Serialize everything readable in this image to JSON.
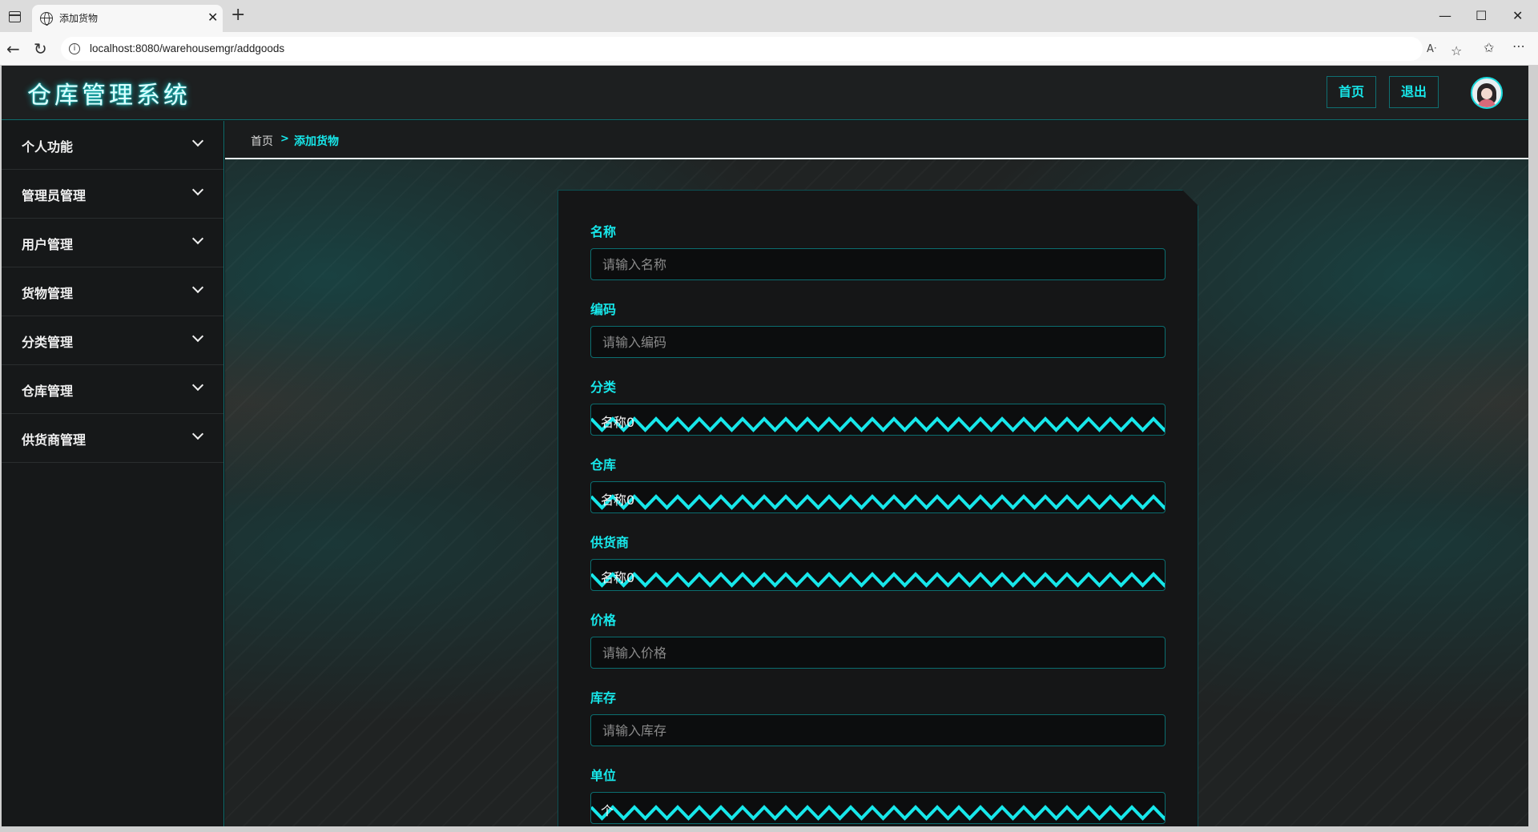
{
  "browser": {
    "tab_title": "添加货物",
    "tab_close": "✕",
    "new_tab": "+",
    "url": "localhost:8080/warehousemgr/addgoods",
    "window_controls": [
      "—",
      "☐",
      "✕"
    ]
  },
  "app": {
    "title": "仓库管理系统",
    "header_buttons": {
      "home": "首页",
      "logout": "退出"
    },
    "accent_color": "#17e7ea"
  },
  "sidebar": {
    "items": [
      {
        "label": "个人功能"
      },
      {
        "label": "管理员管理"
      },
      {
        "label": "用户管理"
      },
      {
        "label": "货物管理"
      },
      {
        "label": "分类管理"
      },
      {
        "label": "仓库管理"
      },
      {
        "label": "供货商管理"
      }
    ]
  },
  "breadcrumb": {
    "home": "首页",
    "separator": ">",
    "current": "添加货物"
  },
  "form": {
    "name": {
      "label": "名称",
      "placeholder": "请输入名称"
    },
    "code": {
      "label": "编码",
      "placeholder": "请输入编码"
    },
    "category": {
      "label": "分类",
      "value": "名称0"
    },
    "warehouse": {
      "label": "仓库",
      "value": "名称0"
    },
    "supplier": {
      "label": "供货商",
      "value": "名称0"
    },
    "price": {
      "label": "价格",
      "placeholder": "请输入价格"
    },
    "stock": {
      "label": "库存",
      "placeholder": "请输入库存"
    },
    "unit": {
      "label": "单位",
      "value": "个"
    }
  }
}
